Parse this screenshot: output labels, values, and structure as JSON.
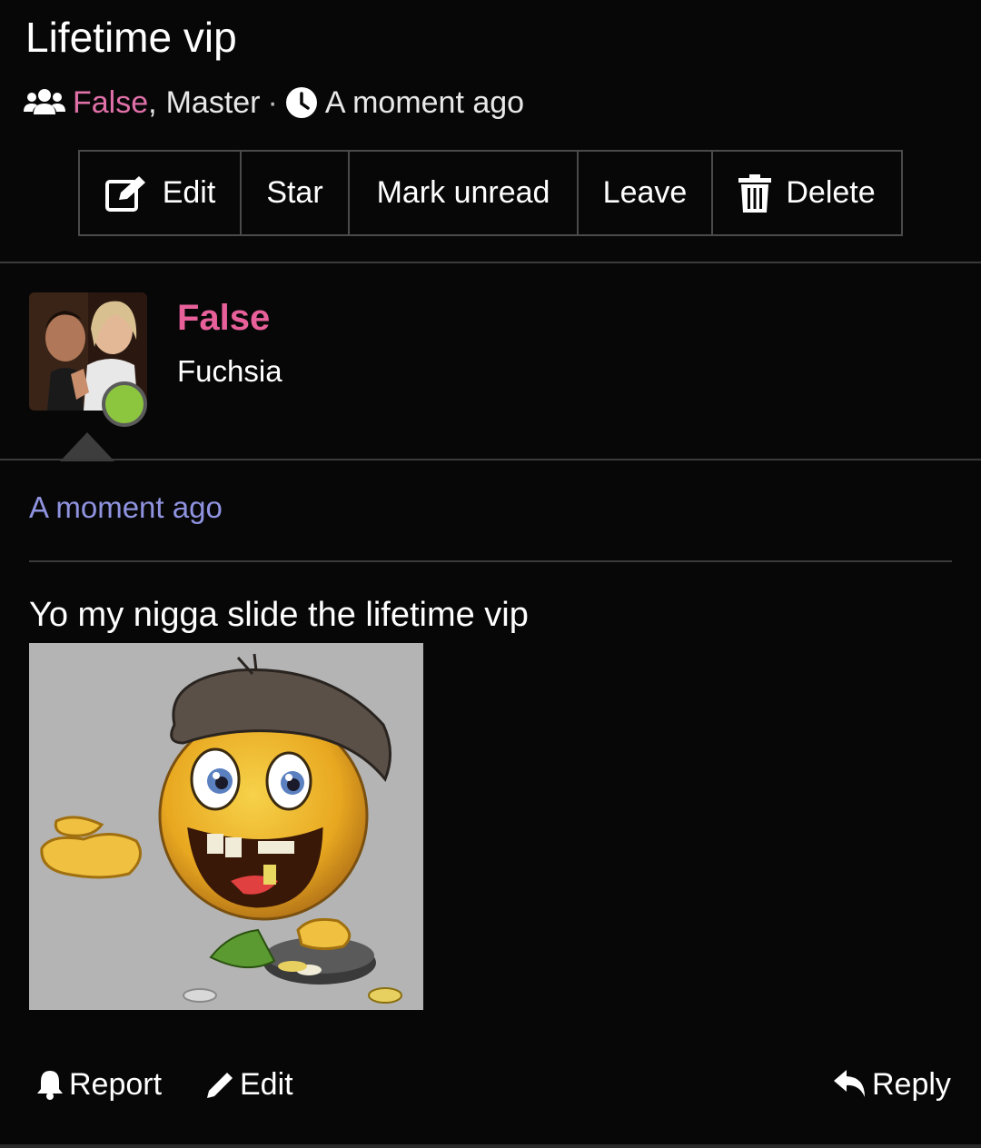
{
  "topic": {
    "title": "Lifetime vip",
    "participants": [
      "False",
      "Master"
    ],
    "separator": ",",
    "dot": "·",
    "time": "A moment ago"
  },
  "toolbar": {
    "edit": "Edit",
    "star": "Star",
    "mark_unread": "Mark unread",
    "leave": "Leave",
    "delete": "Delete"
  },
  "post": {
    "author": "False",
    "rank": "Fuchsia",
    "status": "online",
    "time": "A moment ago",
    "text": "Yo my nigga slide the lifetime vip",
    "image_description": "smiling-emoji-beggar-sticker"
  },
  "actions": {
    "report": "Report",
    "edit": "Edit",
    "reply": "Reply"
  },
  "colors": {
    "background": "#070707",
    "accent_pink": "#e8609a",
    "time_link": "#8f93e0",
    "online": "#8cc63f"
  }
}
